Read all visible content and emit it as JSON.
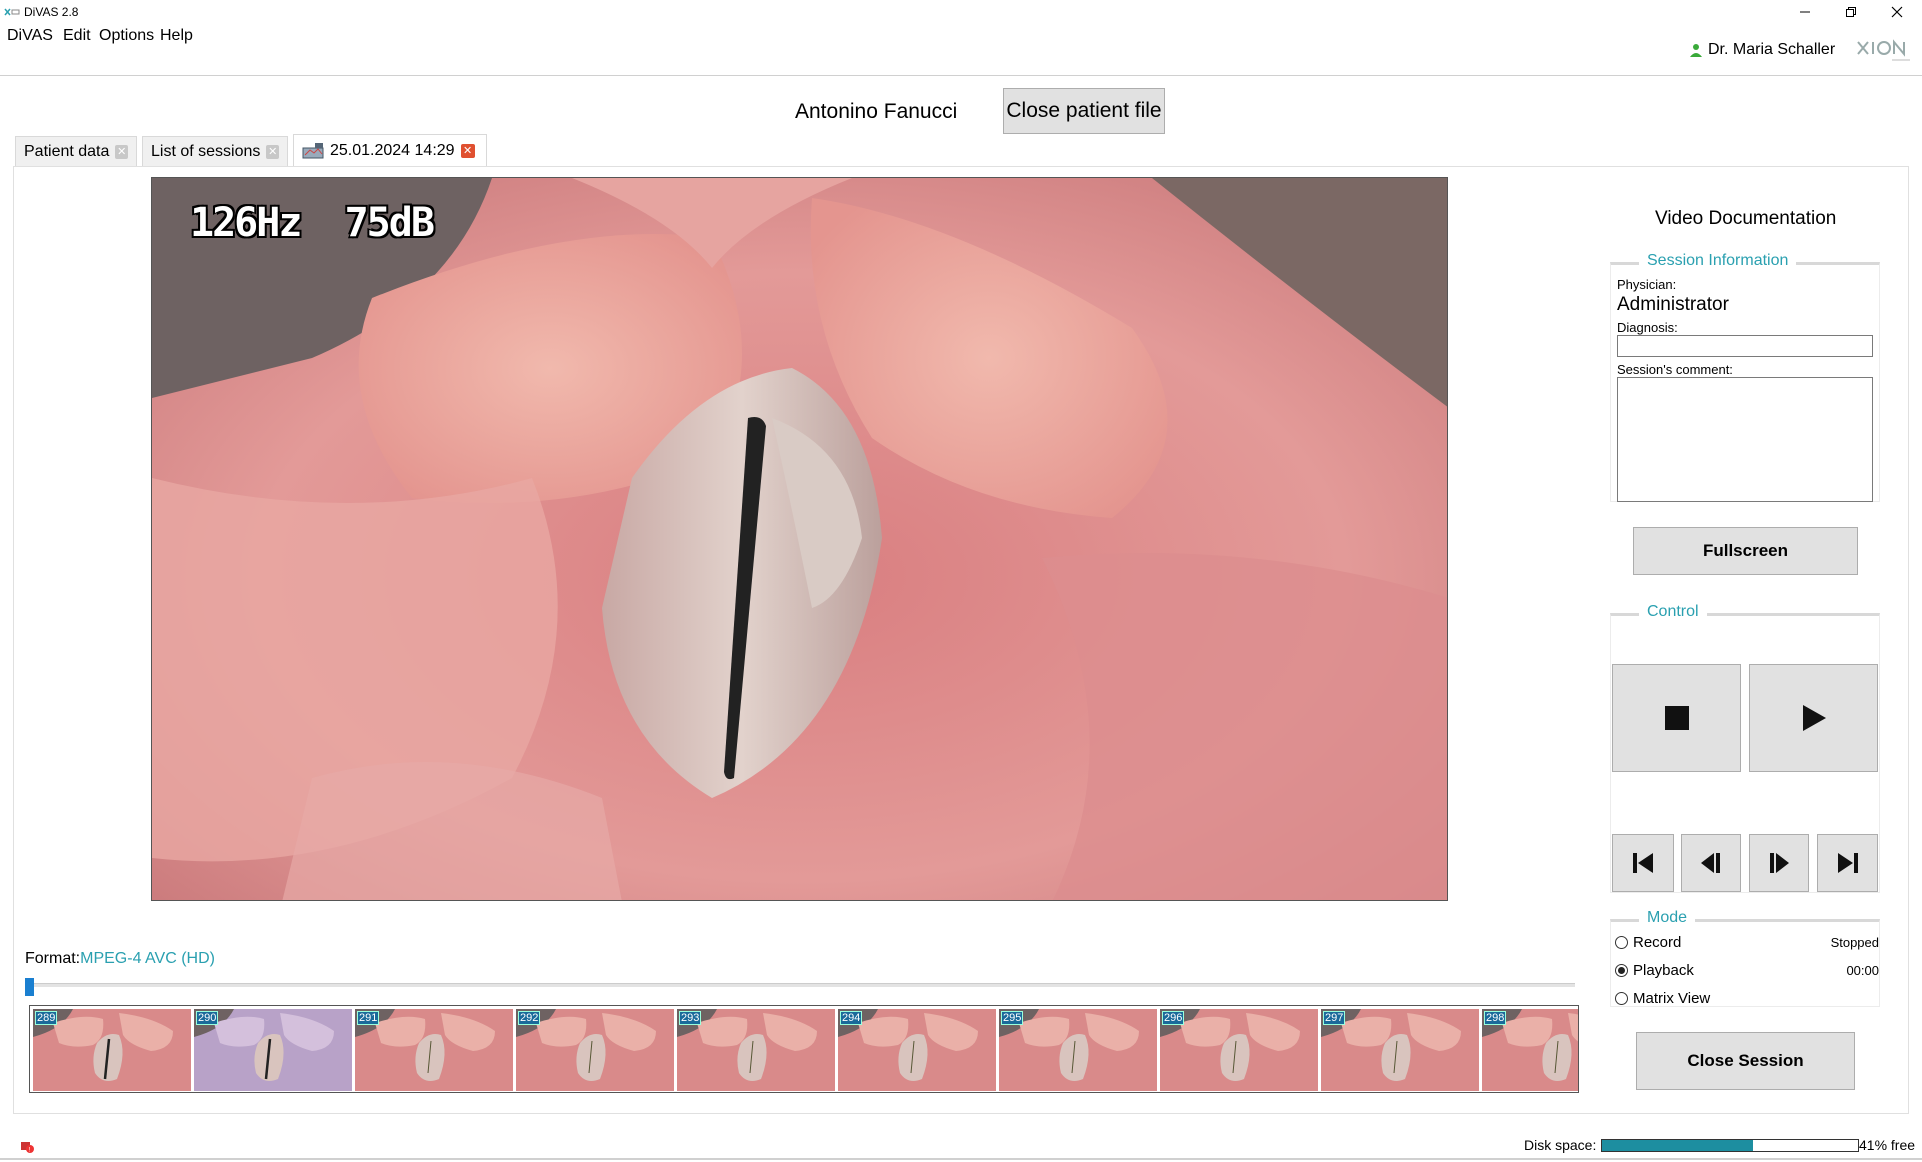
{
  "window": {
    "title": "DiVAS 2.8"
  },
  "menu": [
    "DiVAS",
    "Edit",
    "Options",
    "Help"
  ],
  "user": {
    "name": "Dr. Maria Schaller"
  },
  "patient": {
    "name": "Antonino Fanucci",
    "close_label": "Close patient file"
  },
  "tabs": [
    {
      "label": "Patient data"
    },
    {
      "label": "List of sessions"
    },
    {
      "label": "25.01.2024 14:29",
      "active": true
    }
  ],
  "video": {
    "overlay": "126Hz  75dB"
  },
  "format": {
    "label": "Format:",
    "value": "MPEG-4 AVC (HD)"
  },
  "scrub_position_fraction": 0.0,
  "thumbnails": [
    "289",
    "290",
    "291",
    "292",
    "293",
    "294",
    "295",
    "296",
    "297",
    "298"
  ],
  "panel": {
    "title": "Video Documentation",
    "session_info": {
      "legend": "Session Information",
      "physician_label": "Physician:",
      "physician": "Administrator",
      "diagnosis_label": "Diagnosis:",
      "diagnosis": "",
      "comment_label": "Session's comment:",
      "comment": ""
    },
    "fullscreen_label": "Fullscreen",
    "control": {
      "legend": "Control"
    },
    "mode": {
      "legend": "Mode",
      "options": [
        {
          "label": "Record",
          "status": "Stopped",
          "checked": false
        },
        {
          "label": "Playback",
          "status": "00:00",
          "checked": true
        },
        {
          "label": "Matrix View",
          "status": "",
          "checked": false
        }
      ]
    },
    "close_session_label": "Close Session"
  },
  "status": {
    "disk_label": "Disk space:",
    "disk_free_fraction": 0.59,
    "disk_free_text": "41% free"
  },
  "colors": {
    "accent": "#2aa0b0",
    "disk_bar": "#1d8ea0",
    "active_tab_close": "#e05030"
  }
}
